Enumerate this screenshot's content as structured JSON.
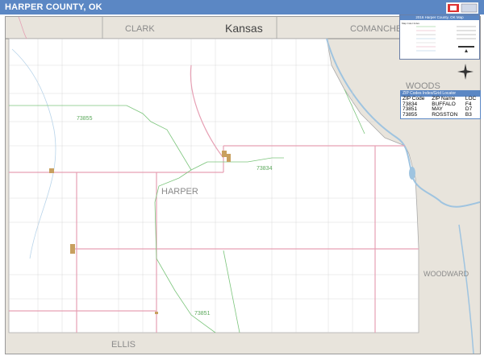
{
  "page": {
    "title": "HARPER COUNTY, OK"
  },
  "neighbors": {
    "state_north": "Kansas",
    "clark": "CLARK",
    "comanche": "COMANCHE",
    "woods": "WOODS",
    "woodward": "WOODWARD",
    "ellis": "ELLIS",
    "county": "HARPER"
  },
  "zip_labels": [
    "73855",
    "73834",
    "73851"
  ],
  "legend": {
    "title": "2016 Harper County, OK Map",
    "subtitle": "Map Color Index"
  },
  "zip_table": {
    "header": "ZIP Codes Index/Grid Locator",
    "columns": [
      "ZIP Code",
      "ZIP Name",
      "LOC"
    ],
    "rows": [
      [
        "73834",
        "BUFFALO",
        "F4"
      ],
      [
        "73851",
        "MAY",
        "D7"
      ],
      [
        "73855",
        "ROSSTON",
        "B3"
      ]
    ]
  },
  "colors": {
    "title_bar": "#5b87c4",
    "county": "#ffffff",
    "surrounding": "#e8e4dc",
    "water": "#9fc4e0",
    "zip_boundary": "#7cc57c",
    "highway": "#e6a0b4",
    "town": "#c8a060"
  }
}
